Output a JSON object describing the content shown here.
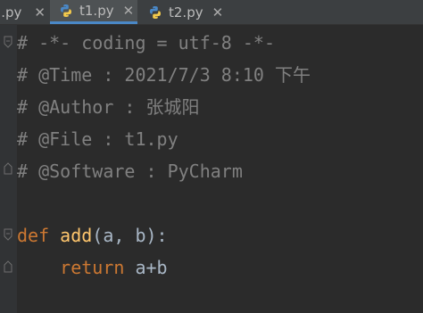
{
  "tabs": [
    {
      "label": "a.py",
      "active": false
    },
    {
      "label": "t1.py",
      "active": true
    },
    {
      "label": "t2.py",
      "active": false
    }
  ],
  "close_glyph": "✕",
  "code": {
    "line1": "# -*- coding = utf-8 -*-",
    "line2": "# @Time : 2021/7/3 8:10 下午",
    "line3": "# @Author : 张城阳",
    "line4": "# @File : t1.py",
    "line5": "# @Software : PyCharm",
    "def_keyword": "def",
    "func_name": "add",
    "params": "(a, b):",
    "return_indent": "    ",
    "return_keyword": "return",
    "return_expr": " a+b"
  },
  "colors": {
    "comment": "#808080",
    "keyword": "#cc7832",
    "function": "#ffc66d",
    "text": "#a9b7c6",
    "background": "#2b2b2b",
    "tab_underline": "#4a88c7"
  },
  "icons": [
    "python-file-icon",
    "close-icon",
    "fold-icon"
  ]
}
